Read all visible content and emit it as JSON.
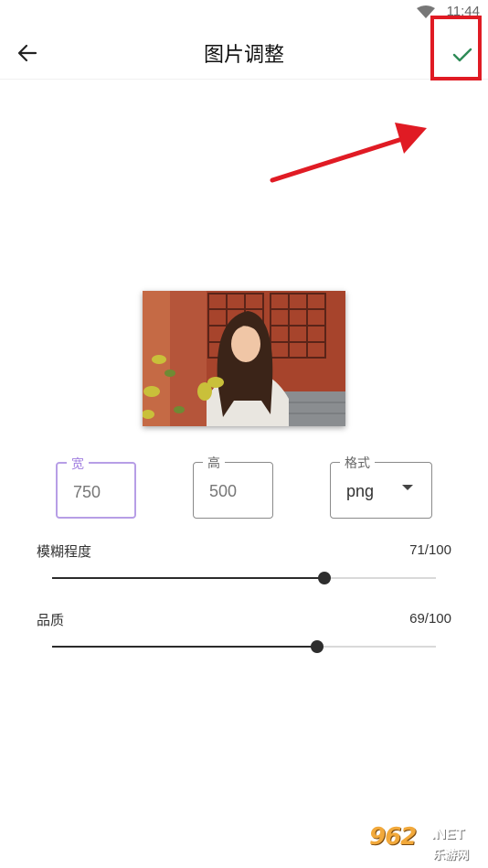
{
  "status_bar": {
    "time": "11:44"
  },
  "app_bar": {
    "title": "图片调整",
    "back_icon": "arrow-left-icon",
    "confirm_icon": "check-icon"
  },
  "fields": {
    "width": {
      "label": "宽",
      "value": "750"
    },
    "height": {
      "label": "高",
      "value": "500"
    },
    "format": {
      "label": "格式",
      "value": "png"
    }
  },
  "sliders": {
    "blur": {
      "label": "模糊程度",
      "value_text": "71/100",
      "value": 71,
      "max": 100
    },
    "quality": {
      "label": "品质",
      "value_text": "69/100",
      "value": 69,
      "max": 100
    }
  },
  "watermark": {
    "brand": "962",
    "net": ".NET",
    "sub": "乐游网"
  },
  "colors": {
    "accent": "#b79ee6",
    "check": "#2e8b57",
    "highlight": "#e01b24"
  }
}
